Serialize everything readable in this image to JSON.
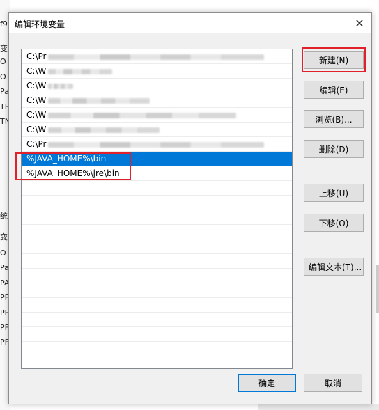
{
  "dialog": {
    "title": "编辑环境变量",
    "close_glyph": "✕"
  },
  "list": {
    "rows": [
      {
        "prefix": "C:\\Pr",
        "selected": false
      },
      {
        "prefix": "C:\\W",
        "selected": false
      },
      {
        "prefix": "C:\\W",
        "selected": false
      },
      {
        "prefix": "C:\\W",
        "selected": false
      },
      {
        "prefix": "C:\\W",
        "selected": false
      },
      {
        "prefix": "C:\\W",
        "selected": false
      },
      {
        "prefix": "C:\\Pr",
        "selected": false
      },
      {
        "prefix": "%JAVA_HOME%\\bin",
        "selected": true
      },
      {
        "prefix": "%JAVA_HOME%\\jre\\bin",
        "selected": false
      }
    ]
  },
  "buttons": {
    "new": "新建(N)",
    "edit": "编辑(E)",
    "browse": "浏览(B)...",
    "delete": "删除(D)",
    "move_up": "上移(U)",
    "move_down": "下移(O)",
    "edit_text": "编辑文本(T)...",
    "ok": "确定",
    "cancel": "取消"
  },
  "background": {
    "fragments": [
      "f9",
      "变",
      "O",
      "O",
      "Pa",
      "TE",
      "TN",
      "统",
      "变",
      "O",
      "Pa",
      "PA",
      "PF",
      "PF",
      "PF",
      "PF"
    ]
  },
  "colors": {
    "selection": "#0078d7",
    "highlight_box": "#e0202a"
  }
}
